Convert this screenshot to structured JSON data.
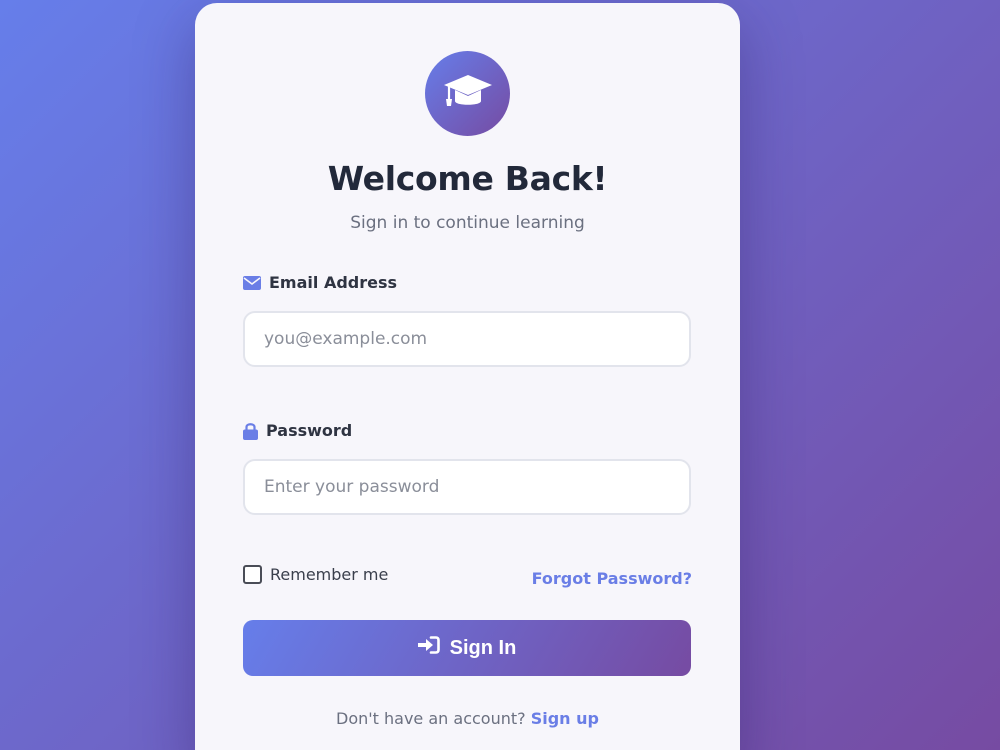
{
  "header": {
    "logo_icon": "graduation-cap-icon",
    "title": "Welcome Back!",
    "subtitle": "Sign in to continue learning"
  },
  "form": {
    "email": {
      "icon": "envelope-icon",
      "label": "Email Address",
      "placeholder": "you@example.com",
      "value": ""
    },
    "password": {
      "icon": "lock-icon",
      "label": "Password",
      "placeholder": "Enter your password",
      "value": ""
    },
    "remember_label": "Remember me",
    "remember_checked": false,
    "forgot_label": "Forgot Password?",
    "submit_icon": "sign-in-icon",
    "submit_label": "Sign In"
  },
  "footer": {
    "prompt": "Don't have an account?",
    "signup_label": "Sign up"
  },
  "colors": {
    "gradient_start": "#667eea",
    "gradient_end": "#764ba2",
    "accent": "#6a7ee6",
    "title": "#22293a"
  }
}
